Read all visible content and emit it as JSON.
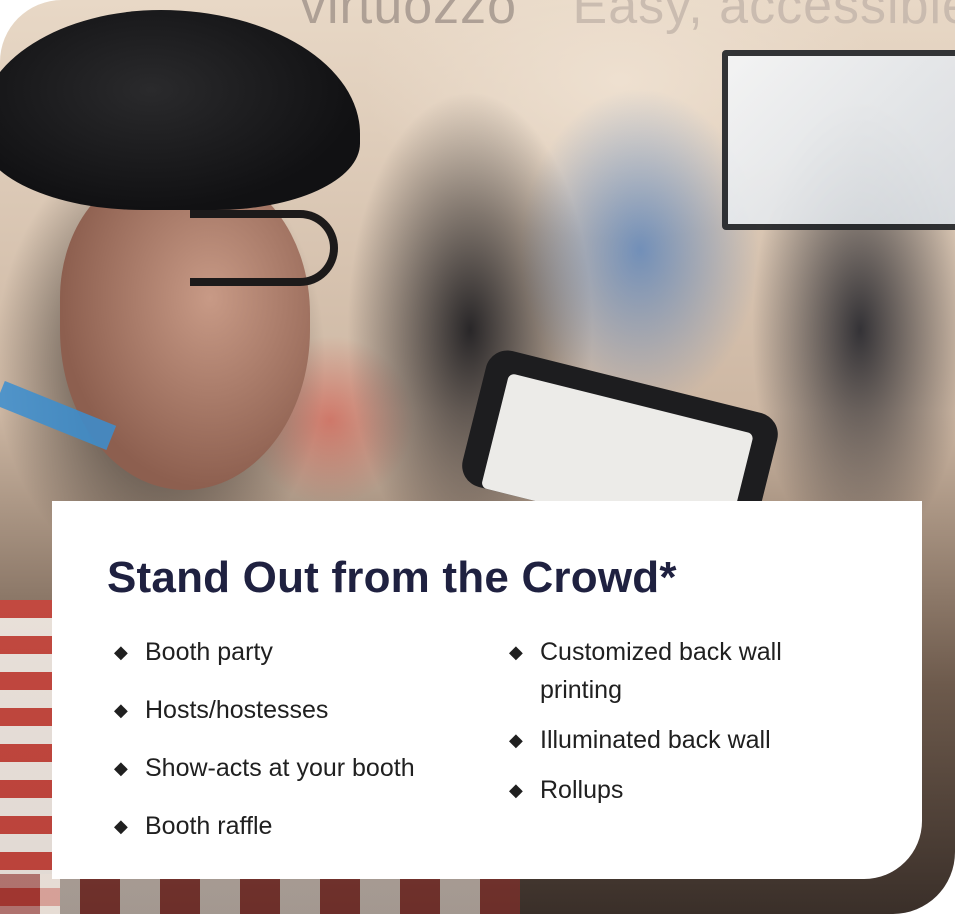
{
  "background": {
    "wall_text": "virtuozzo",
    "wall_tagline": "Easy, accessible, aff"
  },
  "card": {
    "title": "Stand Out from the Crowd*",
    "bullet_icon": "diamond-bullet",
    "left_items": [
      "Booth party",
      "Hosts/hostesses",
      "Show-acts at your booth",
      "Booth raffle"
    ],
    "right_items": [
      "Customized back wall printing",
      "Illuminated back wall",
      "Rollups"
    ]
  },
  "colors": {
    "title": "#1f2140",
    "text": "#202020",
    "card_bg": "#ffffff"
  }
}
